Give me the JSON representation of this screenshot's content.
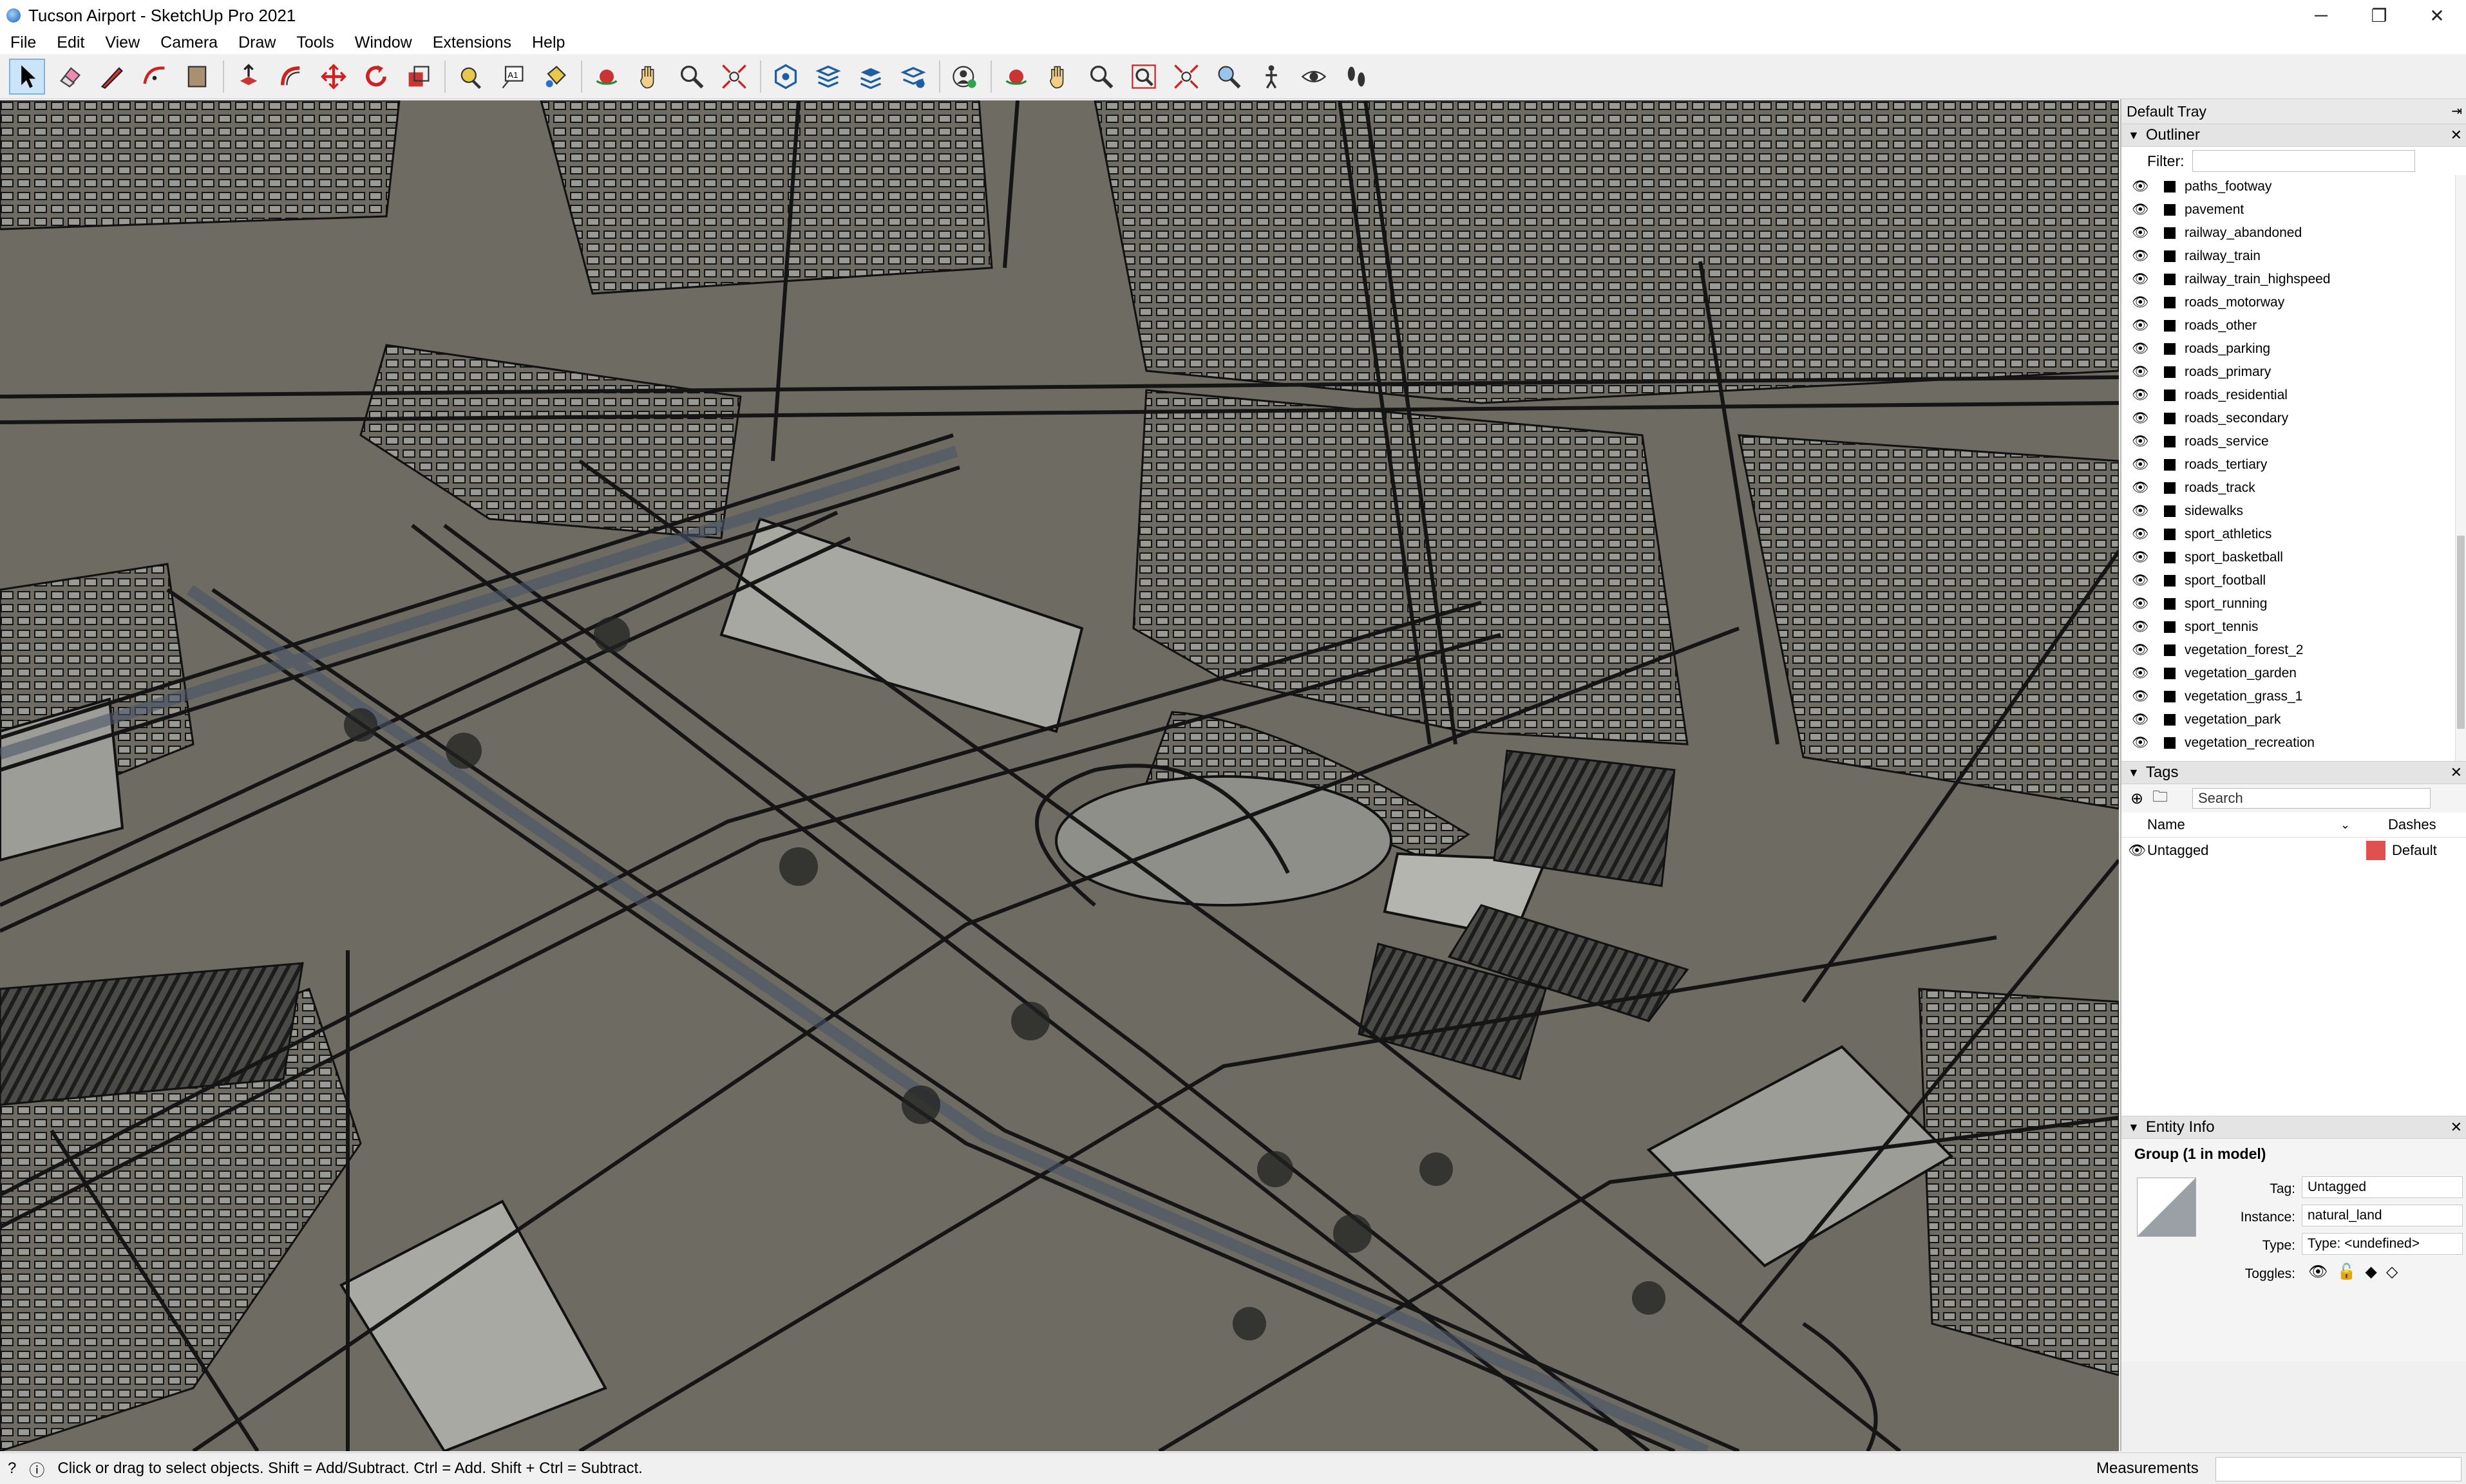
{
  "window": {
    "title": "Tucson Airport - SketchUp Pro 2021",
    "minimize": "─",
    "maximize": "❐",
    "close": "✕"
  },
  "menu": [
    "File",
    "Edit",
    "View",
    "Camera",
    "Draw",
    "Tools",
    "Window",
    "Extensions",
    "Help"
  ],
  "toolbar": {
    "tools": [
      "select-tool",
      "eraser-tool",
      "line-tool",
      "arc-tool",
      "shape-tool",
      "push-pull-tool",
      "offset-tool",
      "move-tool",
      "rotate-tool",
      "scale-tool",
      "tape-measure-tool",
      "text-tool",
      "paint-bucket-tool",
      "orbit-tool",
      "pan-tool",
      "zoom-tool",
      "zoom-extents-tool",
      "warehouse-tool",
      "extension-warehouse-tool",
      "layout-tool",
      "extension-manager-tool",
      "account-tool",
      "orbit-tool-2",
      "pan-tool-2",
      "zoom-tool-2",
      "zoom-window-tool",
      "zoom-extents-tool-2",
      "previous-view-tool",
      "position-camera-tool",
      "look-around-tool",
      "walk-tool"
    ],
    "text_tool_label": "A1"
  },
  "tray": {
    "title": "Default Tray",
    "pin": "⇥",
    "outliner": {
      "title": "Outliner",
      "filter_label": "Filter:",
      "filter_value": "",
      "items": [
        "paths_footway",
        "pavement",
        "railway_abandoned",
        "railway_train",
        "railway_train_highspeed",
        "roads_motorway",
        "roads_other",
        "roads_parking",
        "roads_primary",
        "roads_residential",
        "roads_secondary",
        "roads_service",
        "roads_tertiary",
        "roads_track",
        "sidewalks",
        "sport_athletics",
        "sport_basketball",
        "sport_football",
        "sport_running",
        "sport_tennis",
        "vegetation_forest_2",
        "vegetation_garden",
        "vegetation_grass_1",
        "vegetation_park",
        "vegetation_recreation"
      ]
    },
    "tags": {
      "title": "Tags",
      "search_placeholder": "Search",
      "col_name": "Name",
      "col_dashes": "Dashes",
      "rows": [
        {
          "name": "Untagged",
          "dashes": "Default",
          "color": "#e0504f"
        }
      ]
    },
    "entity_info": {
      "title": "Entity Info",
      "heading": "Group (1 in model)",
      "tag_label": "Tag:",
      "tag_value": "Untagged",
      "instance_label": "Instance:",
      "instance_value": "natural_land",
      "type_label": "Type:",
      "type_value": "Type: <undefined>",
      "toggles_label": "Toggles:"
    }
  },
  "status": {
    "message": "Click or drag to select objects. Shift = Add/Subtract. Ctrl = Add. Shift + Ctrl = Subtract.",
    "measurements_label": "Measurements",
    "measurements_value": ""
  },
  "colors": {
    "ground": "#6d6b62",
    "lines": "#161616",
    "accent": "#cce4f7",
    "tag_color": "#e0504f"
  }
}
